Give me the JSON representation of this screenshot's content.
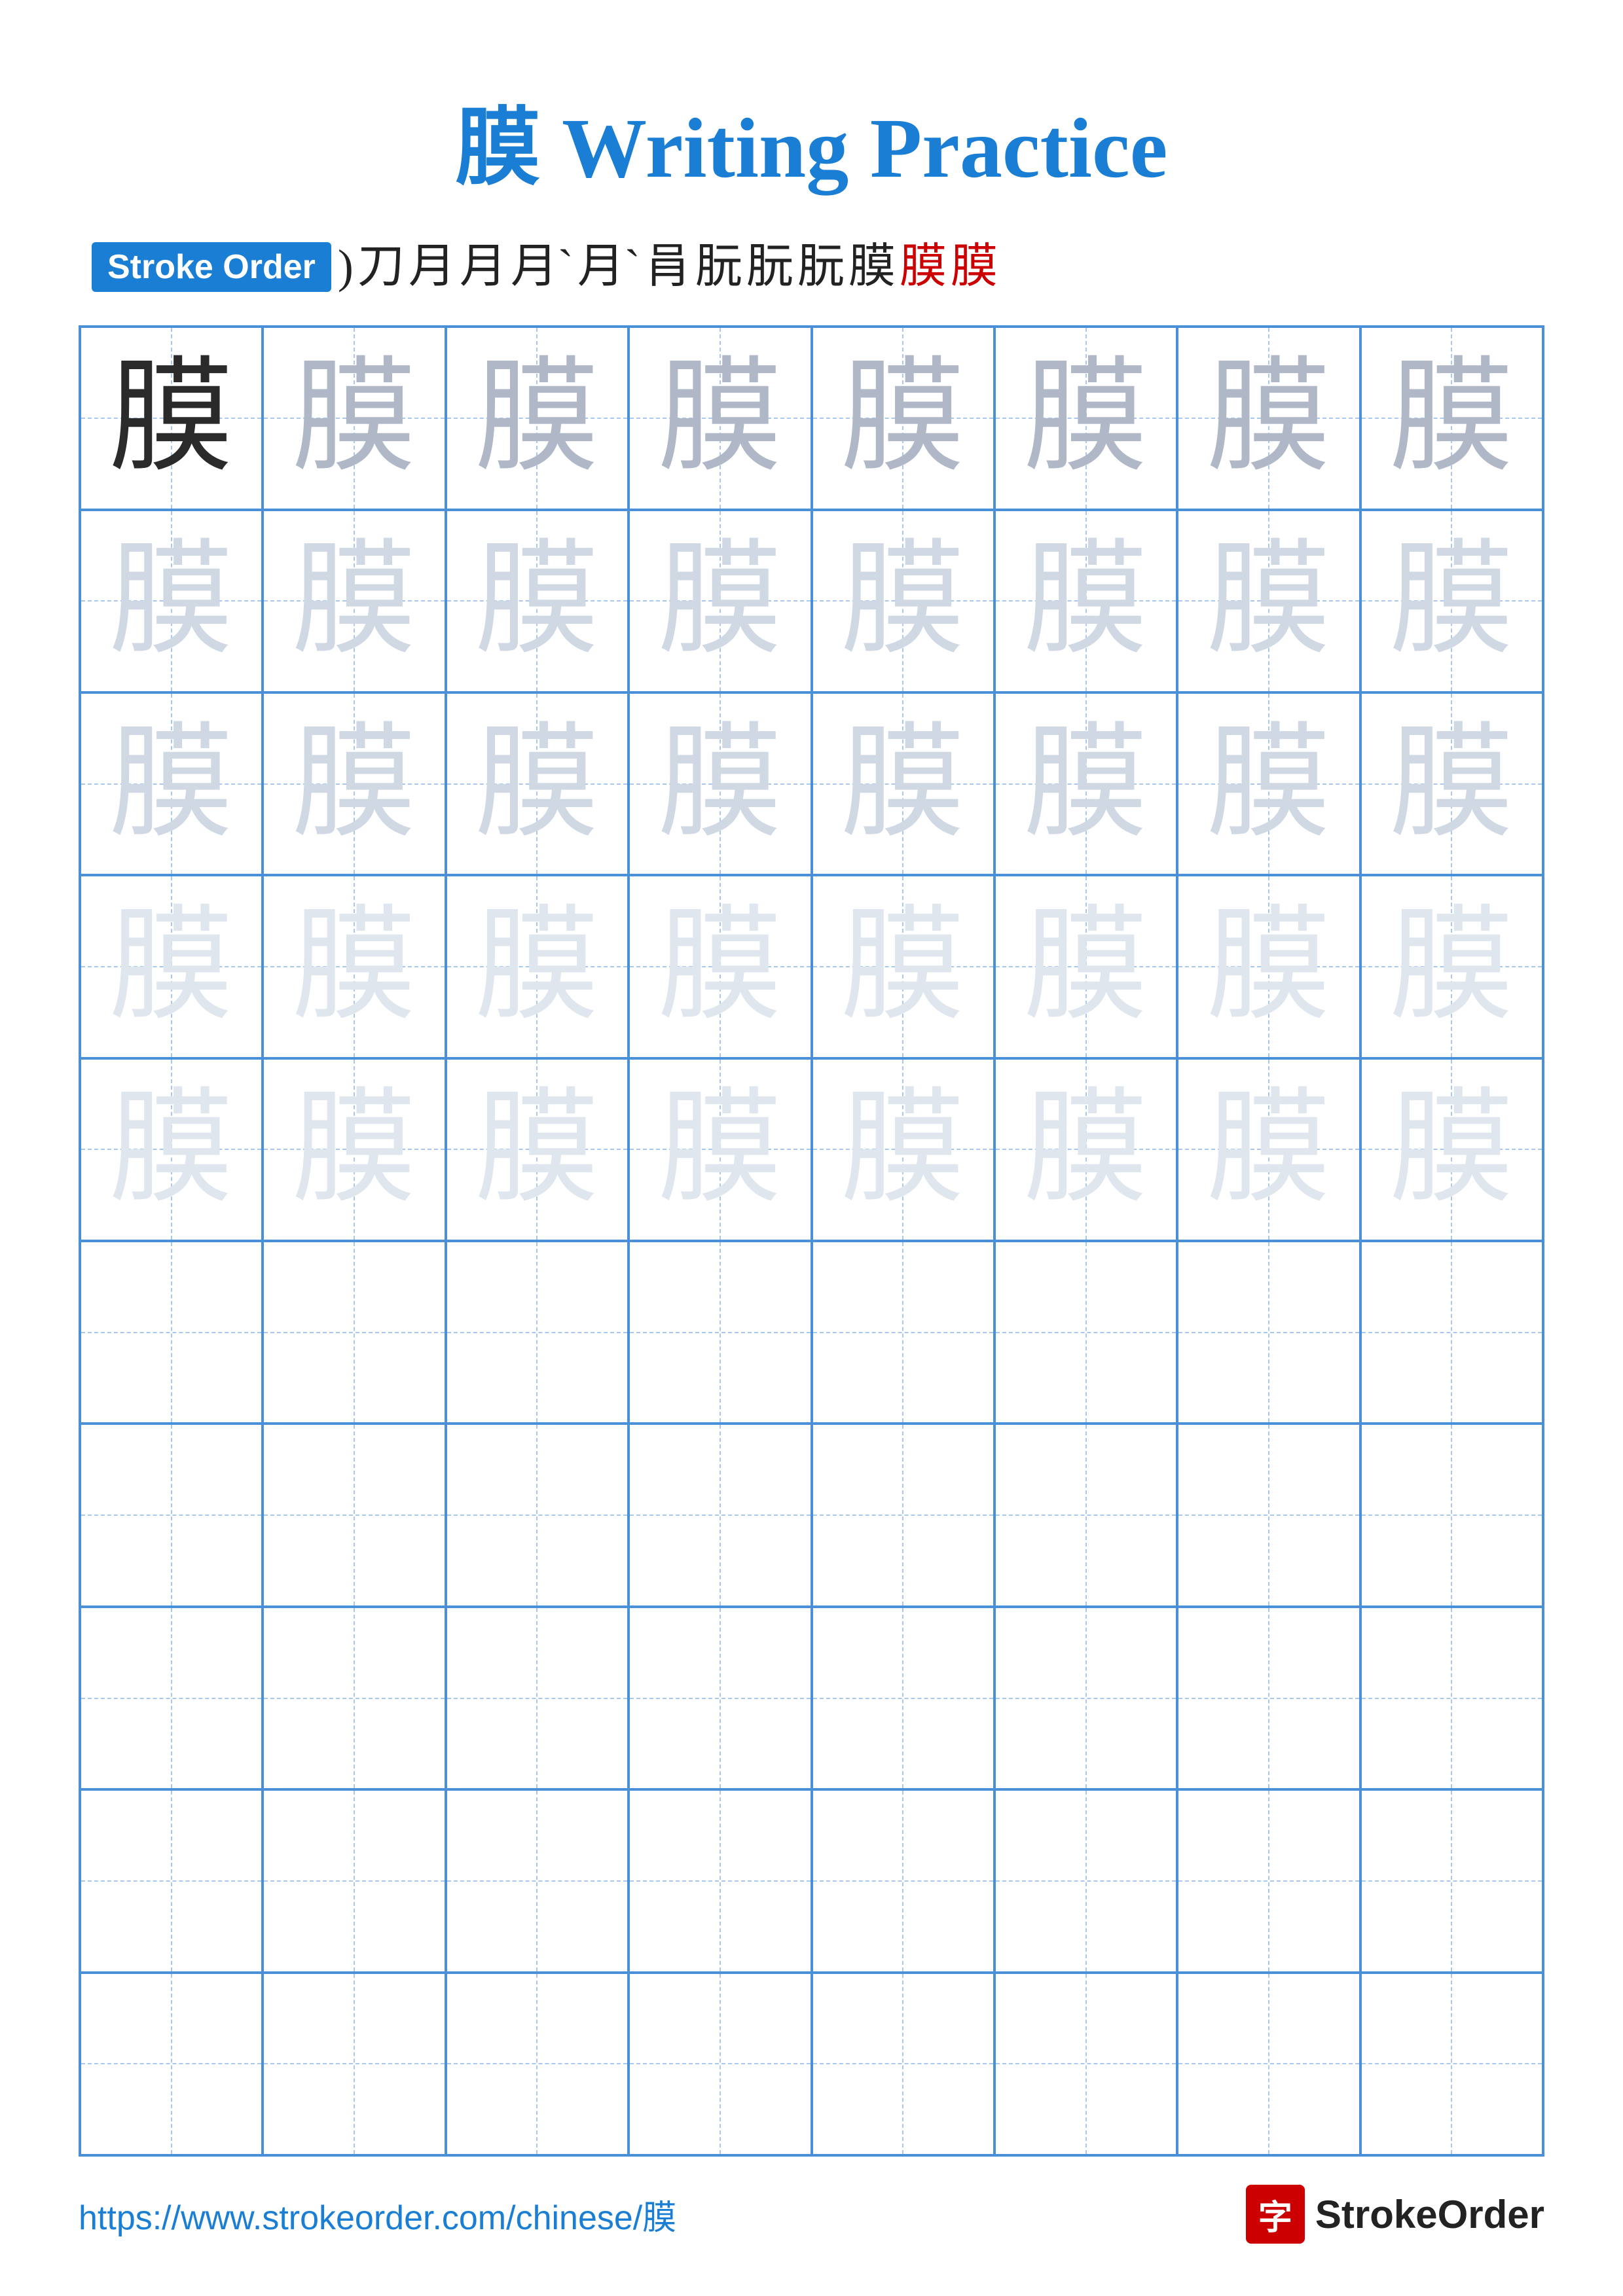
{
  "title": "膜 Writing Practice",
  "stroke_order_label": "Stroke Order",
  "stroke_sequence": [
    "⟩",
    "丿",
    "月",
    "月",
    "月`",
    "月`",
    "肙",
    "朊",
    "朊",
    "朊",
    "膜",
    "膜",
    "膜"
  ],
  "character": "膜",
  "rows": [
    {
      "chars": [
        "膜",
        "膜",
        "膜",
        "膜",
        "膜",
        "膜",
        "膜",
        "膜"
      ],
      "style": [
        "dark",
        "medium",
        "medium",
        "medium",
        "medium",
        "medium",
        "medium",
        "medium"
      ]
    },
    {
      "chars": [
        "膜",
        "膜",
        "膜",
        "膜",
        "膜",
        "膜",
        "膜",
        "膜"
      ],
      "style": [
        "light",
        "light",
        "light",
        "light",
        "light",
        "light",
        "light",
        "light"
      ]
    },
    {
      "chars": [
        "膜",
        "膜",
        "膜",
        "膜",
        "膜",
        "膜",
        "膜",
        "膜"
      ],
      "style": [
        "light",
        "light",
        "light",
        "light",
        "light",
        "light",
        "light",
        "light"
      ]
    },
    {
      "chars": [
        "膜",
        "膜",
        "膜",
        "膜",
        "膜",
        "膜",
        "膜",
        "膜"
      ],
      "style": [
        "very-light",
        "very-light",
        "very-light",
        "very-light",
        "very-light",
        "very-light",
        "very-light",
        "very-light"
      ]
    },
    {
      "chars": [
        "膜",
        "膜",
        "膜",
        "膜",
        "膜",
        "膜",
        "膜",
        "膜"
      ],
      "style": [
        "very-light",
        "very-light",
        "very-light",
        "very-light",
        "very-light",
        "very-light",
        "very-light",
        "very-light"
      ]
    },
    {
      "chars": [
        "",
        "",
        "",
        "",
        "",
        "",
        "",
        ""
      ],
      "style": [
        "empty",
        "empty",
        "empty",
        "empty",
        "empty",
        "empty",
        "empty",
        "empty"
      ]
    },
    {
      "chars": [
        "",
        "",
        "",
        "",
        "",
        "",
        "",
        ""
      ],
      "style": [
        "empty",
        "empty",
        "empty",
        "empty",
        "empty",
        "empty",
        "empty",
        "empty"
      ]
    },
    {
      "chars": [
        "",
        "",
        "",
        "",
        "",
        "",
        "",
        ""
      ],
      "style": [
        "empty",
        "empty",
        "empty",
        "empty",
        "empty",
        "empty",
        "empty",
        "empty"
      ]
    },
    {
      "chars": [
        "",
        "",
        "",
        "",
        "",
        "",
        "",
        ""
      ],
      "style": [
        "empty",
        "empty",
        "empty",
        "empty",
        "empty",
        "empty",
        "empty",
        "empty"
      ]
    },
    {
      "chars": [
        "",
        "",
        "",
        "",
        "",
        "",
        "",
        ""
      ],
      "style": [
        "empty",
        "empty",
        "empty",
        "empty",
        "empty",
        "empty",
        "empty",
        "empty"
      ]
    }
  ],
  "footer_url": "https://www.strokeorder.com/chinese/膜",
  "footer_logo_char": "字",
  "footer_logo_text": "StrokeOrder"
}
